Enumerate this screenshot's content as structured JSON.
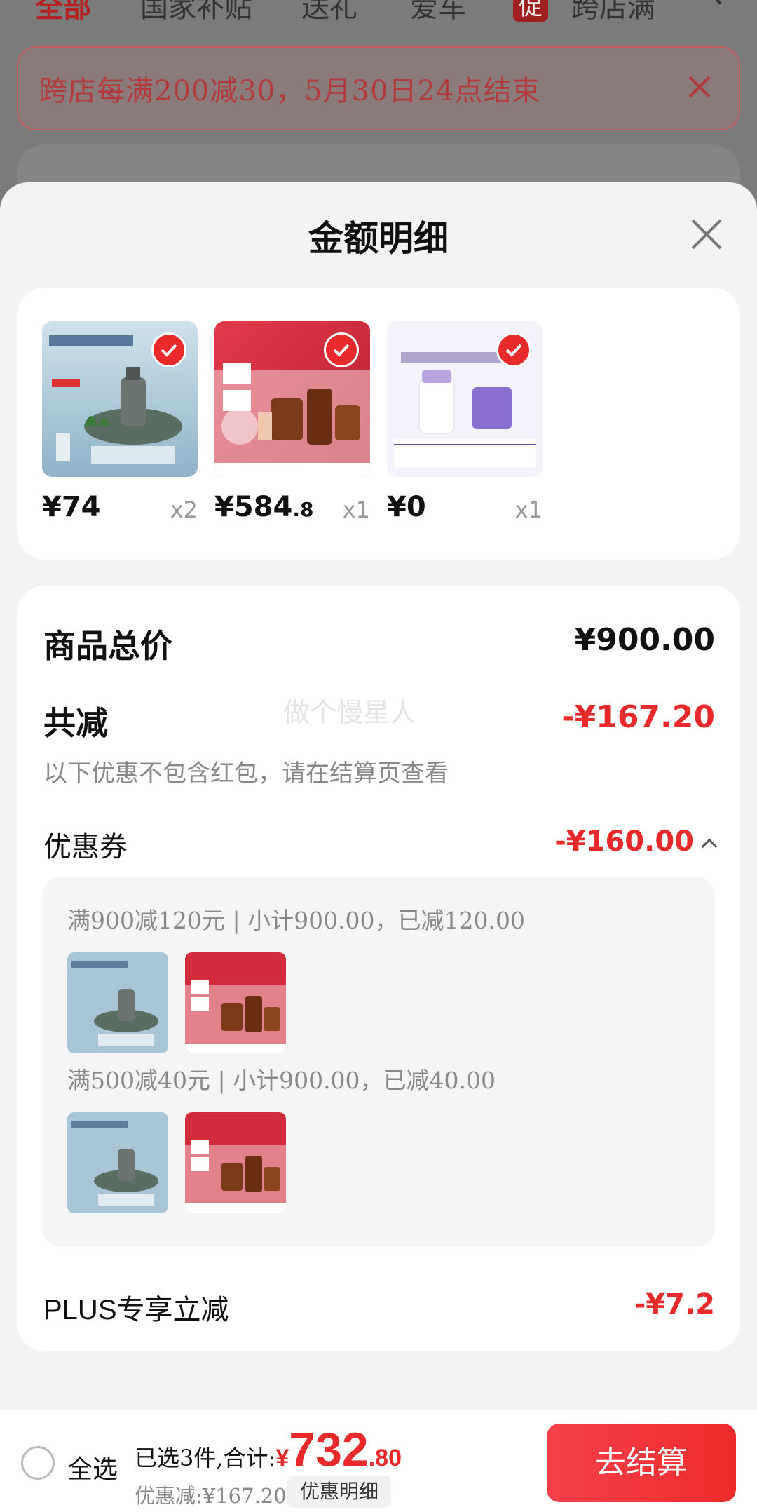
{
  "background": {
    "tabs": [
      "全部",
      "国家补贴",
      "送礼",
      "爱车",
      "促",
      "跨店满减"
    ],
    "banner_text": "跨店每满200减30，5月30日24点结束"
  },
  "sheet": {
    "title": "金额明细",
    "products": [
      {
        "price": "¥74",
        "price_dec": "",
        "qty": "x2",
        "image": "serum-bottle-on-rock"
      },
      {
        "price": "¥584",
        "price_dec": ".8",
        "qty": "x1",
        "image": "estee-lauder-gift-set"
      },
      {
        "price": "¥0",
        "price_dec": "",
        "qty": "x1",
        "image": "coupon-voucher-10"
      }
    ],
    "summary": {
      "total_label": "商品总价",
      "total_value": "¥900.00",
      "discount_label": "共减",
      "discount_value": "-¥167.20",
      "note": "以下优惠不包含红包，请在结算页查看",
      "watermark": "做个慢星人",
      "coupon_label": "优惠券",
      "coupon_value": "-¥160.00",
      "coupons": [
        {
          "line": "满900减120元 | 小计900.00，已减120.00"
        },
        {
          "line": "满500减40元 | 小计900.00，已减40.00"
        }
      ],
      "plus_label": "PLUS专享立减",
      "plus_value": "-¥7.2"
    }
  },
  "bottom_bar": {
    "select_all": "全选",
    "selected_prefix": "已选3件,合计:",
    "currency": "¥",
    "total_int": "732",
    "total_dec": ".80",
    "saved_text": "优惠减:¥167.20",
    "detail_chip": "优惠明细",
    "checkout": "去结算"
  },
  "colors": {
    "accent": "#e82a2a",
    "sheet_bg": "#f3f3f3"
  }
}
